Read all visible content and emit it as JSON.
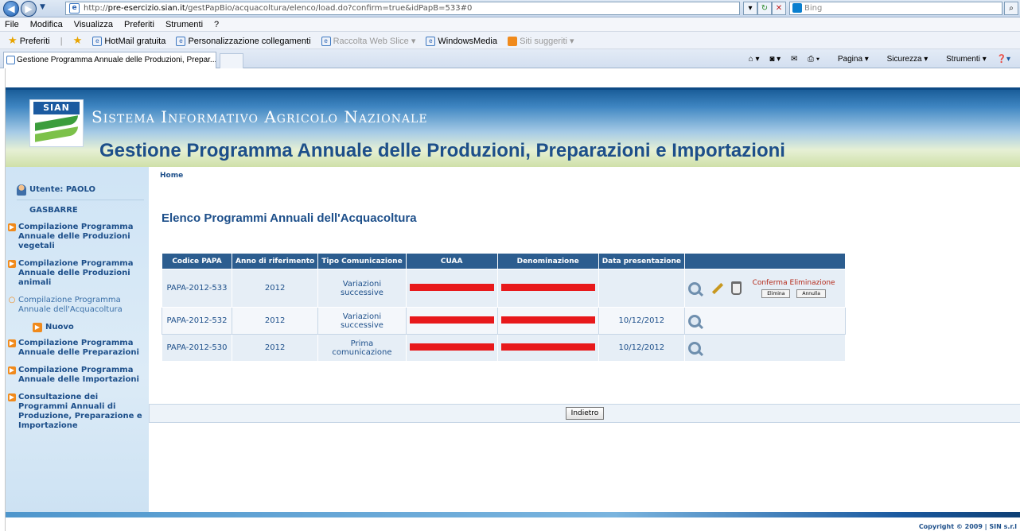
{
  "browser": {
    "url_prefix": "http://",
    "url_host": "pre-esercizio.sian.it",
    "url_path": "/gestPapBio/acquacoltura/elenco/load.do?confirm=true&idPapB=533#0",
    "search_placeholder": "Bing",
    "menu": [
      "File",
      "Modifica",
      "Visualizza",
      "Preferiti",
      "Strumenti",
      "?"
    ],
    "favorites_label": "Preferiti",
    "favorites": [
      {
        "label": "HotMail gratuita",
        "dim": false
      },
      {
        "label": "Personalizzazione collegamenti",
        "dim": false
      },
      {
        "label": "Raccolta Web Slice",
        "dim": true
      },
      {
        "label": "WindowsMedia",
        "dim": false
      },
      {
        "label": "Siti suggeriti",
        "dim": true
      }
    ],
    "tab_title": "Gestione Programma Annuale delle Produzioni, Prepar...",
    "commands": [
      "Pagina",
      "Sicurezza",
      "Strumenti"
    ]
  },
  "header": {
    "logo_text": "SIAN",
    "system_name": "Sistema Informativo Agricolo Nazionale",
    "app_title": "Gestione Programma Annuale delle Produzioni, Preparazioni e Importazioni"
  },
  "sidebar": {
    "user": "Utente: PAOLO GASBARRE",
    "items": [
      {
        "label": "Compilazione Programma Annuale delle Produzioni vegetali"
      },
      {
        "label": "Compilazione Programma Annuale delle Produzioni animali"
      },
      {
        "label": "Compilazione Programma Annuale dell'Acquacoltura"
      },
      {
        "label": "Nuovo"
      },
      {
        "label": "Compilazione Programma Annuale delle Preparazioni"
      },
      {
        "label": "Compilazione Programma Annuale delle Importazioni"
      },
      {
        "label": "Consultazione dei Programmi Annuali di Produzione, Preparazione e Importazione"
      }
    ]
  },
  "main": {
    "breadcrumb": "Home",
    "heading": "Elenco Programmi Annuali dell'Acquacoltura",
    "columns": [
      "Codice PAPA",
      "Anno di riferimento",
      "Tipo Comunicazione",
      "CUAA",
      "Denominazione",
      "Data presentazione"
    ],
    "rows": [
      {
        "codice": "PAPA-2012-533",
        "anno": "2012",
        "tipo": "Variazioni successive",
        "data": ""
      },
      {
        "codice": "PAPA-2012-532",
        "anno": "2012",
        "tipo": "Variazioni successive",
        "data": "10/12/2012"
      },
      {
        "codice": "PAPA-2012-530",
        "anno": "2012",
        "tipo": "Prima comunicazione",
        "data": "10/12/2012"
      }
    ],
    "confirm_label": "Conferma Eliminazione",
    "confirm_delete": "Elimina",
    "confirm_cancel": "Annulla",
    "back_button": "Indietro"
  },
  "footer": {
    "copyright": "Copyright © 2009 | SIN s.r.l"
  }
}
